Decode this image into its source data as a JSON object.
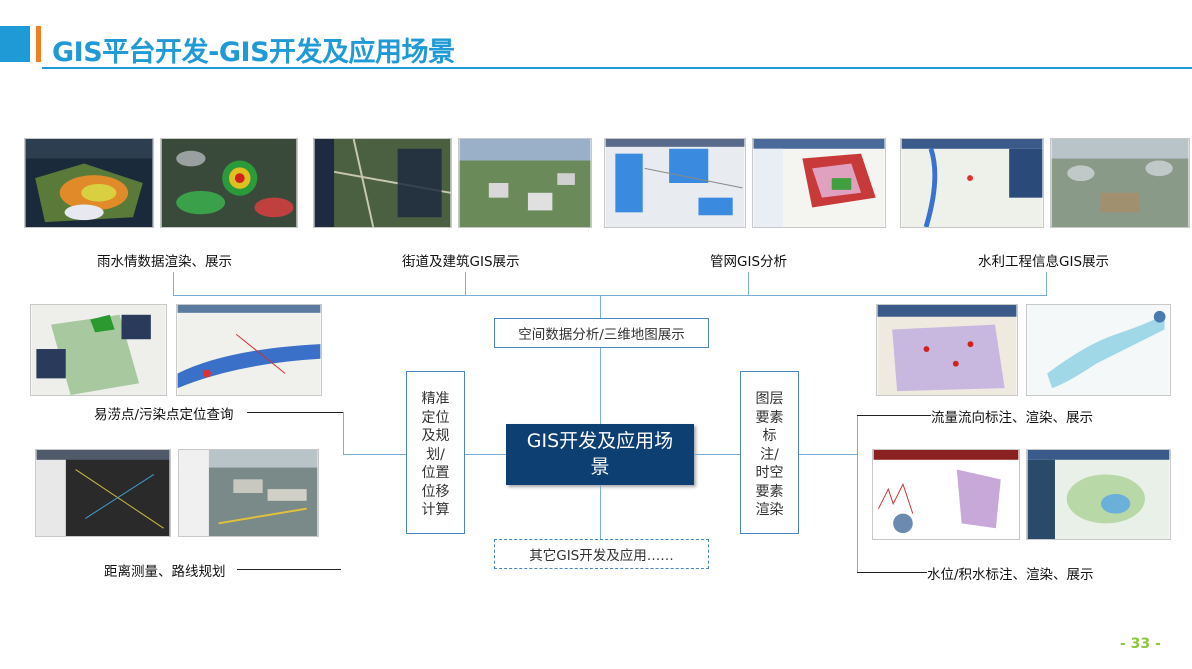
{
  "header": {
    "title": "GIS平台开发-GIS开发及应用场景"
  },
  "top_captions": {
    "rain": "雨水情数据渲染、展示",
    "street": "街道及建筑GIS展示",
    "pipe": "管网GIS分析",
    "water": "水利工程信息GIS展示"
  },
  "left_captions": {
    "flood": "易涝点/污染点定位查询",
    "distance": "距离测量、路线规划"
  },
  "right_captions": {
    "flow": "流量流向标注、渲染、展示",
    "level": "水位/积水标注、渲染、展示"
  },
  "boxes": {
    "spatial": "空间数据分析/三维地图展示",
    "center": "GIS开发及应用场景",
    "other": "其它GIS开发及应用……",
    "left_vertical": "精准定位及规划/位置位移计算",
    "right_vertical": "图层要素标注/时空要素渲染"
  },
  "footer": {
    "page": "- 33 -"
  },
  "colors": {
    "accent": "#1f9ad6",
    "orange": "#f07f1f",
    "center_fill": "#0e3f73",
    "page_green": "#8dc63f"
  }
}
